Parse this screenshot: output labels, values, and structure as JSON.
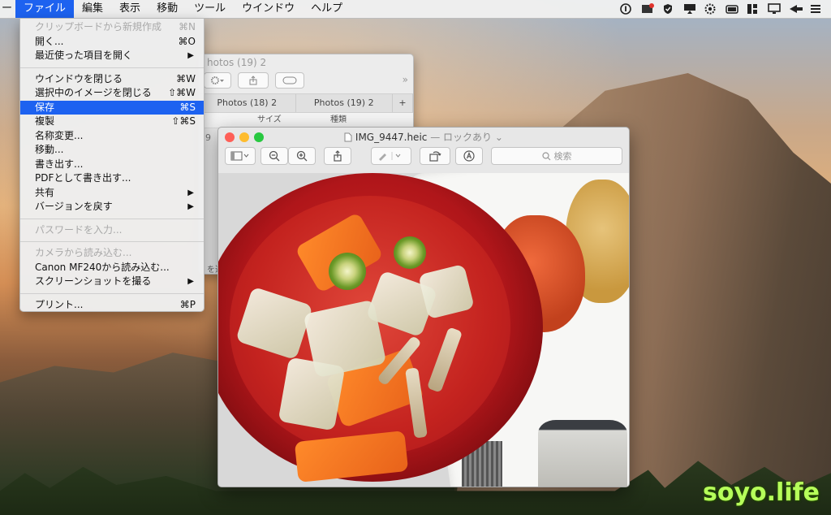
{
  "menubar": {
    "apple_fragment": "ー",
    "items": [
      "ファイル",
      "編集",
      "表示",
      "移動",
      "ツール",
      "ウインドウ",
      "ヘルプ"
    ],
    "active_index": 0,
    "status_icons": [
      "info-icon",
      "photo-sync-icon",
      "shield-icon",
      "airplay-icon",
      "gear-burst-icon",
      "storage-icon",
      "window-icon",
      "display-icon",
      "forward-icon",
      "list-icon"
    ]
  },
  "file_menu": {
    "items": [
      {
        "label": "クリップボードから新規作成",
        "shortcut": "⌘N",
        "disabled": true
      },
      {
        "label": "開く...",
        "shortcut": "⌘O"
      },
      {
        "label": "最近使った項目を開く",
        "submenu": true
      },
      {
        "separator": true
      },
      {
        "label": "ウインドウを閉じる",
        "shortcut": "⌘W"
      },
      {
        "label": "選択中のイメージを閉じる",
        "shortcut": "⇧⌘W"
      },
      {
        "label": "保存",
        "shortcut": "⌘S",
        "selected": true
      },
      {
        "label": "複製",
        "shortcut": "⇧⌘S"
      },
      {
        "label": "名称変更..."
      },
      {
        "label": "移動..."
      },
      {
        "label": "書き出す..."
      },
      {
        "label": "PDFとして書き出す..."
      },
      {
        "label": "共有",
        "submenu": true
      },
      {
        "label": "バージョンを戻す",
        "submenu": true
      },
      {
        "separator": true
      },
      {
        "label": "パスワードを入力...",
        "disabled": true
      },
      {
        "separator": true
      },
      {
        "label": "カメラから読み込む...",
        "disabled": true
      },
      {
        "label": "Canon MF240から読み込む..."
      },
      {
        "label": "スクリーンショットを撮る",
        "submenu": true
      },
      {
        "separator": true
      },
      {
        "label": "プリント...",
        "shortcut": "⌘P"
      }
    ],
    "submenu_arrow": "▶"
  },
  "bg_window": {
    "title": "hotos (19) 2",
    "tabs": [
      "Photos (18) 2",
      "Photos (19) 2"
    ],
    "add_tab": "+",
    "overflow": "»",
    "columns": [
      "サイズ",
      "種類"
    ],
    "side_fragment": "9",
    "bottom_fragment": "を選"
  },
  "preview": {
    "title": "IMG_9447.heic",
    "lock_text": "— ロックあり",
    "lock_chevron": "⌄",
    "search_placeholder": "検索",
    "toolbar_icons": [
      "sidebar-icon",
      "zoom-out-icon",
      "zoom-in-icon",
      "share-icon",
      "markup-pen-icon",
      "rotate-icon",
      "annotate-icon"
    ]
  },
  "colors": {
    "menu_highlight": "#1d62f0",
    "close": "#fe5f57",
    "minimize": "#febc2e",
    "zoom": "#28c840",
    "watermark": "#b6ff5a"
  },
  "watermark": "soyo.life"
}
